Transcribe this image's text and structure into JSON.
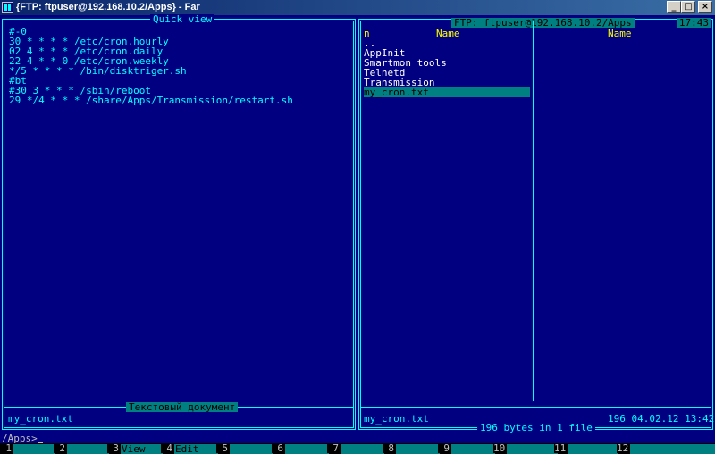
{
  "window": {
    "title": "{FTP: ftpuser@192.168.10.2/Apps} - Far",
    "minimize": "_",
    "maximize": "□",
    "close": "×"
  },
  "left_panel": {
    "caption": "Quick view",
    "lines": [
      "#-0",
      "30 * * * * /etc/cron.hourly",
      "02 4 * * * /etc/cron.daily",
      "22 4 * * 0 /etc/cron.weekly",
      "*/5 * * * * /bin/disktriger.sh",
      "#bt",
      "#30 3 * * * /sbin/reboot",
      "29 */4 * * * /share/Apps/Transmission/restart.sh"
    ],
    "bottom_caption": "Текстовый документ",
    "status_filename": "my_cron.txt"
  },
  "right_panel": {
    "caption": "FTP: ftpuser@192.168.10.2/Apps",
    "clock": "17:43",
    "col_n": "n",
    "col_name_1": "Name",
    "col_name_2": "Name",
    "files": [
      "..",
      "AppInit",
      "Smartmon tools",
      "Telnetd",
      "Transmission",
      "my_cron.txt"
    ],
    "selected_index": 5,
    "status_filename": "my_cron.txt",
    "status_info": "196 04.02.12 13:42",
    "summary": "196 bytes in 1 file"
  },
  "command_line": {
    "prompt": "/Apps>"
  },
  "keybar": [
    {
      "num": "1",
      "label": ""
    },
    {
      "num": "2",
      "label": ""
    },
    {
      "num": "3",
      "label": "View"
    },
    {
      "num": "4",
      "label": "Edit"
    },
    {
      "num": "5",
      "label": ""
    },
    {
      "num": "6",
      "label": ""
    },
    {
      "num": "7",
      "label": ""
    },
    {
      "num": "8",
      "label": ""
    },
    {
      "num": "9",
      "label": ""
    },
    {
      "num": "10",
      "label": ""
    },
    {
      "num": "11",
      "label": ""
    },
    {
      "num": "12",
      "label": ""
    }
  ]
}
